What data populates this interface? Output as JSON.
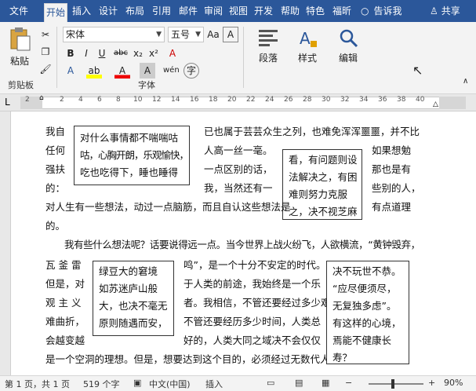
{
  "ribbon_tabs": [
    "文件",
    "开始",
    "插入",
    "设计",
    "布局",
    "引用",
    "邮件",
    "审阅",
    "视图",
    "开发",
    "帮助",
    "特色",
    "福昕"
  ],
  "tell_me": "告诉我",
  "share": "共享",
  "clipboard": {
    "paste": "粘贴",
    "group": "剪贴板"
  },
  "font": {
    "name": "宋体",
    "size": "五号",
    "group": "字体",
    "bold": "B",
    "italic": "I",
    "underline": "U",
    "strike": "abc",
    "sub": "x₂",
    "sup": "x²",
    "clear_format": "A",
    "grow": "A",
    "shrink": "A",
    "case": "Aa",
    "char_border": "A",
    "text_effect": "A",
    "highlight": "ab",
    "font_color": "A",
    "char_shading": "A",
    "phonetic": "wén",
    "enclose": "字"
  },
  "paragraph": {
    "label": "段落"
  },
  "styles": {
    "label": "样式"
  },
  "editing": {
    "label": "编辑"
  },
  "ruler_ticks": [
    "2",
    "2",
    "4",
    "6",
    "8",
    "10",
    "12",
    "14",
    "16",
    "18",
    "20",
    "22",
    "24",
    "26",
    "28",
    "30",
    "32",
    "34",
    "36",
    "38",
    "40"
  ],
  "doc": {
    "lines": [
      "我自",
      "任何",
      "强扶",
      "的：",
      "已也属于芸芸众生之列，也难免浑浑噩噩，并不比",
      "人高一丝一毫。",
      "一点区别的话，",
      "我，当然还有一",
      "如果想勉",
      "那也是有",
      "些别的人，",
      "有点道理",
      "对人生有一些想法，动过一点脑筋，而且自认这些想法是",
      "的。",
      "我有些什么想法呢？话要说得远一点。当今世界上战火纷飞，人欲横流，“黄钟毁弃，",
      "瓦  釜  雷",
      "但是，对",
      "观  主  义",
      "难曲折，",
      "会越变越",
      "是一个空洞的理想。但是，想要达到这个目的，必须经过无数代人",
      "鸣”，是一个十分不安定的时代。",
      "于人类的前途，我始终是一个乐",
      "者。我相信，不管还要经过多少艰",
      "不管还要经历多少时间，人类总",
      "好的，人类大同之域决不会仅仅"
    ],
    "box1": [
      "对什么事情都不喘喘咕",
      "咕，心胸开朗，乐观愉快，",
      "吃也吃得下，睡也睡得"
    ],
    "box2": [
      "看，有问题则设",
      "法解决之，有困",
      "难则努力克服",
      "之，决不视芝麻"
    ],
    "box3": [
      "绿豆大的窘境",
      "如苏迷庐山般",
      "大，也决不毫无",
      "原则随遇而安，"
    ],
    "box4": [
      "决不玩世不恭。",
      "“应尽便须尽，",
      "无复独多虑”。",
      "有这样的心境，",
      "焉能不健康长",
      "寿？"
    ]
  },
  "status": {
    "page": "第 1 页，共 1 页",
    "words": "519 个字",
    "lang": "中文(中国)",
    "mode": "插入",
    "zoom": "90%"
  }
}
